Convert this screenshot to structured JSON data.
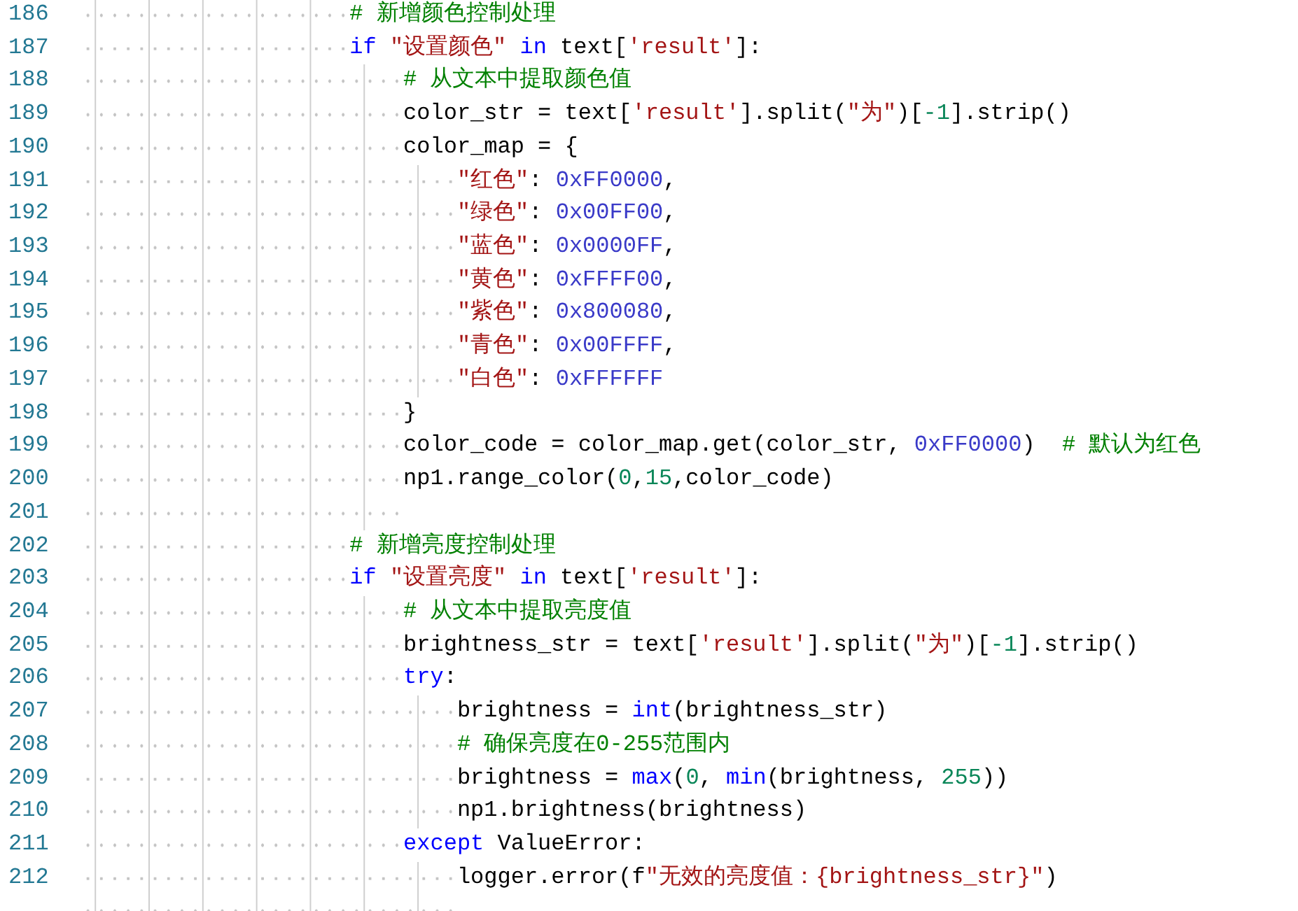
{
  "editor": {
    "lines": [
      {
        "number": "186",
        "tokens": [
          {
            "kind": "comment",
            "text": "# 新增颜色控制处理"
          }
        ]
      },
      {
        "number": "187",
        "tokens": [
          {
            "kind": "keyword",
            "text": "if "
          },
          {
            "kind": "string",
            "text": "\"设置颜色\""
          },
          {
            "kind": "keyword",
            "text": " in"
          },
          {
            "kind": "plain",
            "text": " text["
          },
          {
            "kind": "string",
            "text": "'result'"
          },
          {
            "kind": "plain",
            "text": "]:"
          }
        ],
        "children": [
          {
            "number": "188",
            "tokens": [
              {
                "kind": "comment",
                "text": "# 从文本中提取颜色值"
              }
            ]
          },
          {
            "number": "189",
            "tokens": [
              {
                "kind": "plain",
                "text": "color_str = text["
              },
              {
                "kind": "string",
                "text": "'result'"
              },
              {
                "kind": "plain",
                "text": "].split("
              },
              {
                "kind": "string",
                "text": "\"为\""
              },
              {
                "kind": "plain",
                "text": ")["
              },
              {
                "kind": "number",
                "text": "-1"
              },
              {
                "kind": "plain",
                "text": "].strip()"
              }
            ]
          },
          {
            "number": "190",
            "tokens": [
              {
                "kind": "plain",
                "text": "color_map = {"
              }
            ],
            "children": [
              {
                "number": "191",
                "tokens": [
                  {
                    "kind": "string",
                    "text": "\"红色\""
                  },
                  {
                    "kind": "plain",
                    "text": ": "
                  },
                  {
                    "kind": "hex",
                    "text": "0xFF0000"
                  },
                  {
                    "kind": "plain",
                    "text": ","
                  }
                ]
              },
              {
                "number": "192",
                "tokens": [
                  {
                    "kind": "string",
                    "text": "\"绿色\""
                  },
                  {
                    "kind": "plain",
                    "text": ": "
                  },
                  {
                    "kind": "hex",
                    "text": "0x00FF00"
                  },
                  {
                    "kind": "plain",
                    "text": ","
                  }
                ]
              },
              {
                "number": "193",
                "tokens": [
                  {
                    "kind": "string",
                    "text": "\"蓝色\""
                  },
                  {
                    "kind": "plain",
                    "text": ": "
                  },
                  {
                    "kind": "hex",
                    "text": "0x0000FF"
                  },
                  {
                    "kind": "plain",
                    "text": ","
                  }
                ]
              },
              {
                "number": "194",
                "tokens": [
                  {
                    "kind": "string",
                    "text": "\"黄色\""
                  },
                  {
                    "kind": "plain",
                    "text": ": "
                  },
                  {
                    "kind": "hex",
                    "text": "0xFFFF00"
                  },
                  {
                    "kind": "plain",
                    "text": ","
                  }
                ]
              },
              {
                "number": "195",
                "tokens": [
                  {
                    "kind": "string",
                    "text": "\"紫色\""
                  },
                  {
                    "kind": "plain",
                    "text": ": "
                  },
                  {
                    "kind": "hex",
                    "text": "0x800080"
                  },
                  {
                    "kind": "plain",
                    "text": ","
                  }
                ]
              },
              {
                "number": "196",
                "tokens": [
                  {
                    "kind": "string",
                    "text": "\"青色\""
                  },
                  {
                    "kind": "plain",
                    "text": ": "
                  },
                  {
                    "kind": "hex",
                    "text": "0x00FFFF"
                  },
                  {
                    "kind": "plain",
                    "text": ","
                  }
                ]
              },
              {
                "number": "197",
                "tokens": [
                  {
                    "kind": "string",
                    "text": "\"白色\""
                  },
                  {
                    "kind": "plain",
                    "text": ": "
                  },
                  {
                    "kind": "hex",
                    "text": "0xFFFFFF"
                  }
                ]
              }
            ]
          },
          {
            "number": "198",
            "tokens": [
              {
                "kind": "plain",
                "text": "}"
              }
            ]
          },
          {
            "number": "199",
            "tokens": [
              {
                "kind": "plain",
                "text": "color_code = color_map.get(color_str, "
              },
              {
                "kind": "hex",
                "text": "0xFF0000"
              },
              {
                "kind": "plain",
                "text": ")"
              },
              {
                "kind": "comment",
                "text": "  # 默认为红色"
              }
            ]
          },
          {
            "number": "200",
            "tokens": [
              {
                "kind": "plain",
                "text": "np1.range_color("
              },
              {
                "kind": "number",
                "text": "0"
              },
              {
                "kind": "plain",
                "text": ","
              },
              {
                "kind": "number",
                "text": "15"
              },
              {
                "kind": "plain",
                "text": ",color_code)"
              }
            ]
          },
          {
            "number": "201"
          }
        ]
      },
      {
        "number": "202",
        "tokens": [
          {
            "kind": "comment",
            "text": "# 新增亮度控制处理"
          }
        ]
      },
      {
        "number": "203",
        "tokens": [
          {
            "kind": "keyword",
            "text": "if "
          },
          {
            "kind": "string",
            "text": "\"设置亮度\""
          },
          {
            "kind": "keyword",
            "text": " in"
          },
          {
            "kind": "plain",
            "text": " text["
          },
          {
            "kind": "string",
            "text": "'result'"
          },
          {
            "kind": "plain",
            "text": "]:"
          }
        ],
        "children": [
          {
            "number": "204",
            "tokens": [
              {
                "kind": "comment",
                "text": "# 从文本中提取亮度值"
              }
            ]
          },
          {
            "number": "205",
            "tokens": [
              {
                "kind": "plain",
                "text": "brightness_str = text["
              },
              {
                "kind": "string",
                "text": "'result'"
              },
              {
                "kind": "plain",
                "text": "].split("
              },
              {
                "kind": "string",
                "text": "\"为\""
              },
              {
                "kind": "plain",
                "text": ")["
              },
              {
                "kind": "number",
                "text": "-1"
              },
              {
                "kind": "plain",
                "text": "].strip()"
              }
            ]
          },
          {
            "number": "206",
            "tokens": [
              {
                "kind": "keyword",
                "text": "try"
              },
              {
                "kind": "plain",
                "text": ":"
              }
            ],
            "children": [
              {
                "number": "207",
                "tokens": [
                  {
                    "kind": "plain",
                    "text": "brightness = "
                  },
                  {
                    "kind": "builtin",
                    "text": "int"
                  },
                  {
                    "kind": "plain",
                    "text": "(brightness_str)"
                  }
                ]
              },
              {
                "number": "208",
                "tokens": [
                  {
                    "kind": "comment",
                    "text": "# 确保亮度在0-255范围内"
                  }
                ]
              },
              {
                "number": "209",
                "tokens": [
                  {
                    "kind": "plain",
                    "text": "brightness = "
                  },
                  {
                    "kind": "builtin",
                    "text": "max"
                  },
                  {
                    "kind": "plain",
                    "text": "("
                  },
                  {
                    "kind": "number",
                    "text": "0"
                  },
                  {
                    "kind": "plain",
                    "text": ", "
                  },
                  {
                    "kind": "builtin",
                    "text": "min"
                  },
                  {
                    "kind": "plain",
                    "text": "(brightness, "
                  },
                  {
                    "kind": "number",
                    "text": "255"
                  },
                  {
                    "kind": "plain",
                    "text": "))"
                  }
                ]
              },
              {
                "number": "210",
                "tokens": [
                  {
                    "kind": "plain",
                    "text": "np1.brightness(brightness)"
                  }
                ]
              }
            ]
          },
          {
            "number": "211",
            "tokens": [
              {
                "kind": "keyword",
                "text": "except"
              },
              {
                "kind": "plain",
                "text": " ValueError:"
              }
            ],
            "children": [
              {
                "number": "212",
                "tokens": [
                  {
                    "kind": "plain",
                    "text": "logger.error(f"
                  },
                  {
                    "kind": "string",
                    "text": "\"无效的亮度值：{brightness_str}\""
                  },
                  {
                    "kind": "plain",
                    "text": ")"
                  }
                ]
              }
            ]
          }
        ]
      }
    ]
  }
}
